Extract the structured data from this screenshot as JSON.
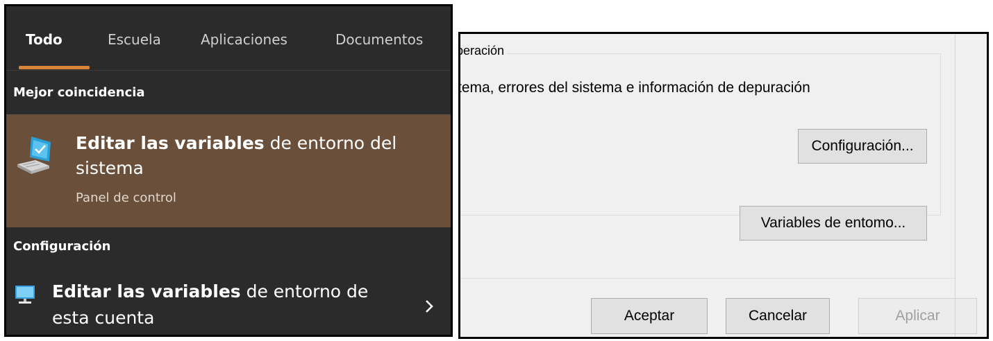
{
  "search": {
    "tabs": [
      {
        "label": "Todo",
        "active": true
      },
      {
        "label": "Escuela",
        "active": false
      },
      {
        "label": "Aplicaciones",
        "active": false
      },
      {
        "label": "Documentos",
        "active": false
      }
    ],
    "best_match": {
      "header": "Mejor coincidencia",
      "title_bold": "Editar las variables",
      "title_rest": " de entorno del sistema",
      "subtitle": "Panel de control",
      "icon": "computer-settings-icon"
    },
    "settings": {
      "header": "Configuración",
      "item": {
        "title_bold": "Editar las variables",
        "title_rest": " de entorno de esta cuenta",
        "icon": "monitor-icon",
        "chevron": "chevron-right-icon"
      }
    },
    "colors": {
      "panel_bg": "#2b2b2b",
      "accent": "#d9843b",
      "highlight": "#6a4f3a"
    }
  },
  "dialog": {
    "group_label": "peración",
    "group_description": "tema, errores del sistema e información de depuración",
    "config_button": "Configuración...",
    "env_button": "Variables de entomo...",
    "ok_button": "Aceptar",
    "cancel_button": "Cancelar",
    "apply_button": "Aplicar",
    "apply_enabled": false
  }
}
